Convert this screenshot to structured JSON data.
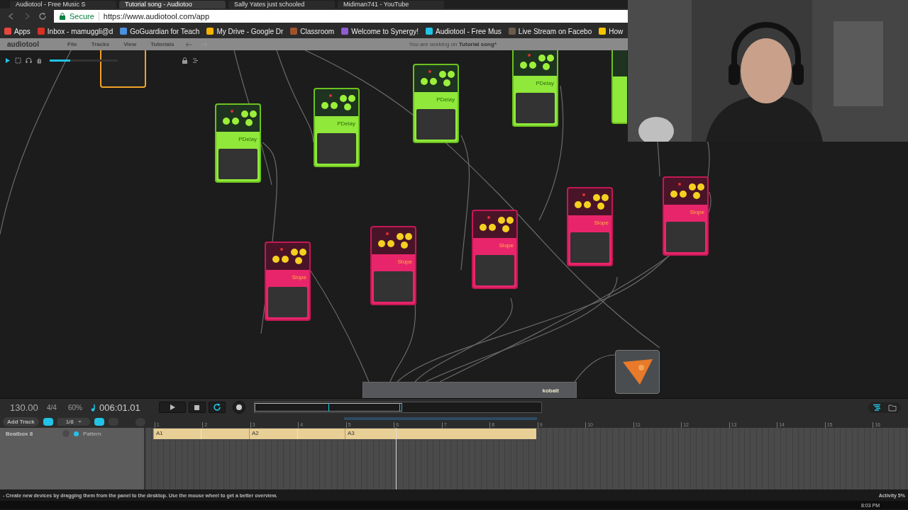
{
  "browser": {
    "tabs": [
      {
        "title": "Audiotool - Free Music S",
        "selected": false
      },
      {
        "title": "Tutorial song - Audiotoo",
        "selected": true
      },
      {
        "title": "Sally Yates just schooled",
        "selected": false
      },
      {
        "title": "Midiman741 - YouTube",
        "selected": false
      }
    ],
    "secure_label": "Secure",
    "url": "https://www.audiotool.com/app",
    "bookmarks": [
      {
        "label": "Apps",
        "color": "#e8453c"
      },
      {
        "label": "Inbox - mamuggli@d",
        "color": "#d93025"
      },
      {
        "label": "GoGuardian for Teach",
        "color": "#4a90e2"
      },
      {
        "label": "My Drive - Google Dr",
        "color": "#f4b400"
      },
      {
        "label": "Classroom",
        "color": "#a0522d"
      },
      {
        "label": "Welcome to Synergy!",
        "color": "#8e5bd0"
      },
      {
        "label": "Audiotool - Free Mus",
        "color": "#22c3e6"
      },
      {
        "label": "Live Stream on Facebo",
        "color": "#6b5b4b"
      },
      {
        "label": "How",
        "color": "#f5c400"
      }
    ]
  },
  "app": {
    "logo": "audiotool",
    "menu": [
      "File",
      "Tracks",
      "View",
      "Tutorials"
    ],
    "working_on": "You are working on",
    "song": "Tutorial song*"
  },
  "desktop": {
    "devices": [
      {
        "kind": "orange"
      },
      {
        "kind": "pdelay",
        "label": "PDelay"
      },
      {
        "kind": "pdelay",
        "label": "PDelay"
      },
      {
        "kind": "pdelay",
        "label": "PDelay"
      },
      {
        "kind": "pdelay",
        "label": "PDelay"
      },
      {
        "kind": "edge"
      },
      {
        "kind": "slope",
        "label": "Slope"
      },
      {
        "kind": "slope",
        "label": "Slope"
      },
      {
        "kind": "slope",
        "label": "Slope"
      },
      {
        "kind": "slope",
        "label": "Slope"
      },
      {
        "kind": "slope",
        "label": "Slope"
      },
      {
        "kind": "mixer",
        "label": "kobalt"
      },
      {
        "kind": "triangle"
      }
    ],
    "tools": {
      "volume": {
        "level": 0.3
      }
    }
  },
  "transport": {
    "tempo": "130.00",
    "signature": "4/4",
    "zoom": "60%",
    "time": "006:01.01",
    "loop": {
      "on": true
    }
  },
  "tracks": {
    "add_track": "Add Track",
    "snap": {
      "on": true
    },
    "grid": "1/8",
    "ruler": [
      "1",
      "2",
      "3",
      "4",
      "5",
      "6",
      "7",
      "8",
      "9",
      "10",
      "11",
      "12",
      "13",
      "14",
      "15",
      "16"
    ],
    "list": [
      {
        "name": "Beatbox 8",
        "color": "#22c3e6",
        "pattern": "Pattern"
      }
    ],
    "clips": [
      {
        "label": "A1"
      },
      {
        "label": "A2"
      },
      {
        "label": "A3"
      }
    ]
  },
  "status_bar": {
    "hint": "- Create new devices by dragging them from the panel to the desktop. Use the mouse wheel to get a better overview.",
    "activity": "Activity 5%"
  },
  "taskbar": {
    "clock": "8:03 PM"
  }
}
